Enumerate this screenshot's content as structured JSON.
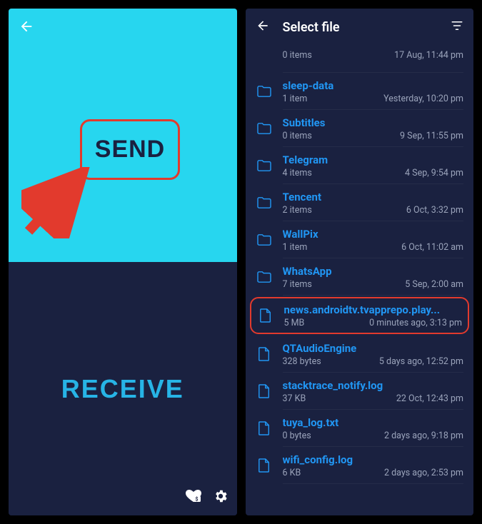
{
  "left": {
    "send_label": "SEND",
    "receive_label": "RECEIVE"
  },
  "right": {
    "header_title": "Select file",
    "items": [
      {
        "type": "folder",
        "name": "",
        "sub_left": "0 items",
        "sub_right": "17 Aug, 11:44 pm",
        "partial": true
      },
      {
        "type": "folder",
        "name": "sleep-data",
        "sub_left": "1 item",
        "sub_right": "Yesterday, 10:20 pm"
      },
      {
        "type": "folder",
        "name": "Subtitles",
        "sub_left": "0 items",
        "sub_right": "9 Sep, 11:55 pm"
      },
      {
        "type": "folder",
        "name": "Telegram",
        "sub_left": "4 items",
        "sub_right": "4 Sep, 9:54 pm"
      },
      {
        "type": "folder",
        "name": "Tencent",
        "sub_left": "2 items",
        "sub_right": "6 Oct, 3:32 pm"
      },
      {
        "type": "folder",
        "name": "WallPix",
        "sub_left": "1 item",
        "sub_right": "6 Oct, 11:02 am"
      },
      {
        "type": "folder",
        "name": "WhatsApp",
        "sub_left": "7 items",
        "sub_right": "5 Sep, 2:00 am"
      },
      {
        "type": "file",
        "name": "news.androidtv.tvapprepo.play...",
        "sub_left": "5 MB",
        "sub_right": "0 minutes ago, 3:13 pm",
        "highlight": true
      },
      {
        "type": "file",
        "name": "QTAudioEngine",
        "sub_left": "328 bytes",
        "sub_right": "5 days ago, 12:52 pm"
      },
      {
        "type": "file",
        "name": "stacktrace_notify.log",
        "sub_left": "37 KB",
        "sub_right": "22 Oct, 12:43 pm"
      },
      {
        "type": "file",
        "name": "tuya_log.txt",
        "sub_left": "0 bytes",
        "sub_right": "2 days ago, 9:18 pm"
      },
      {
        "type": "file",
        "name": "wifi_config.log",
        "sub_left": "6 KB",
        "sub_right": "2 days ago, 2:53 pm"
      }
    ]
  }
}
